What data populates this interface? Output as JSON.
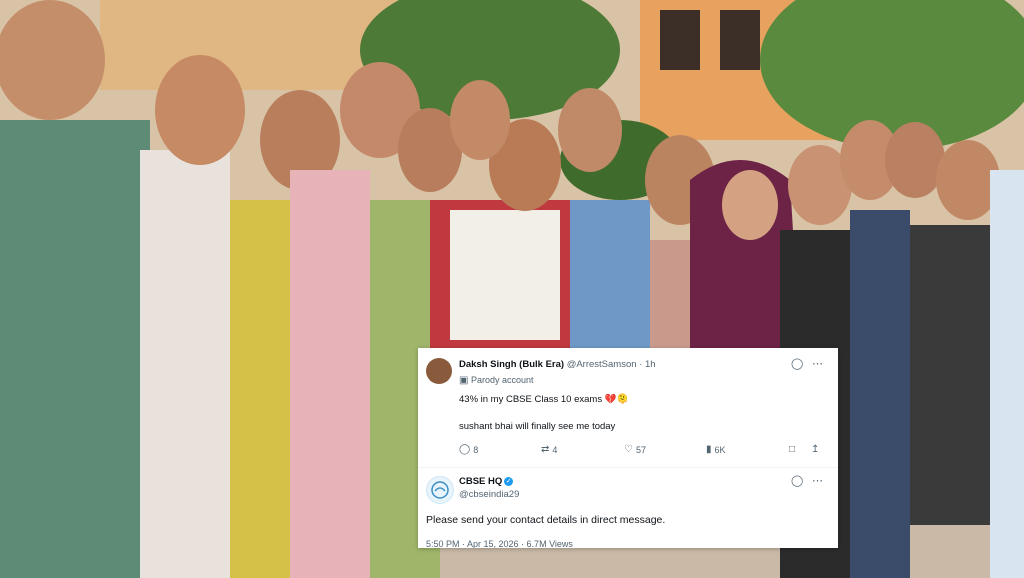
{
  "tweet": {
    "author_name": "Daksh Singh (Bulk Era)",
    "handle": "@ArrestSamson",
    "time": "· 1h",
    "account_label": "Parody account",
    "line1": "43% in my CBSE Class 10 exams 💔🫠",
    "line2": "sushant bhai will finally see me today",
    "actions": {
      "replies": "8",
      "reposts": "4",
      "likes": "57",
      "views": "6K"
    }
  },
  "reply": {
    "author_name": "CBSE HQ",
    "handle": "@cbseindia29",
    "text": "Please send your contact details in direct message.",
    "footer": "5:50 PM · Apr 15, 2026 · 6.7M Views"
  },
  "icons": {
    "grok": "grok-icon",
    "more": "more-icon",
    "reply": "reply-icon",
    "repost": "repost-icon",
    "like": "heart-icon",
    "views": "views-icon",
    "bookmark": "bookmark-icon",
    "share": "share-icon",
    "verified": "verified-icon"
  },
  "colors": {
    "accent": "#1d9bf0",
    "text": "#0f1419",
    "muted": "#536471"
  }
}
